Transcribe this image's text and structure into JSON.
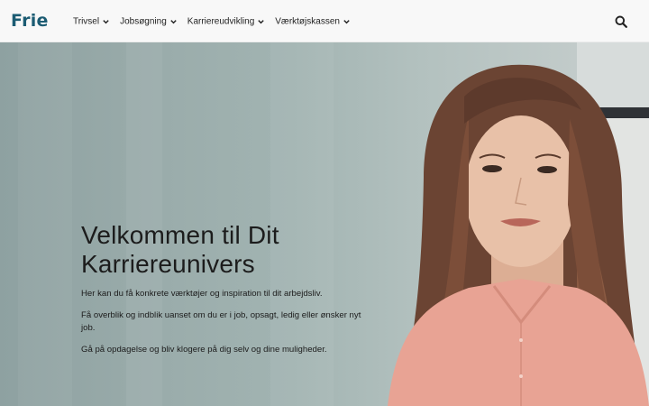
{
  "header": {
    "logo": "Frie",
    "nav": [
      {
        "label": "Trivsel"
      },
      {
        "label": "Jobsøgning"
      },
      {
        "label": "Karriereudvikling"
      },
      {
        "label": "Værktøjskassen"
      }
    ],
    "search_icon": "search-icon"
  },
  "hero": {
    "title": "Velkommen til Dit Karriereunivers",
    "paragraphs": [
      "Her kan du få konkrete værktøjer og inspiration til dit arbejdsliv.",
      "Få overblik og indblik uanset om du er i job, opsagt, ledig eller ønsker nyt job.",
      "Gå på opdagelse og bliv klogere på dig selv og dine muligheder."
    ]
  },
  "colors": {
    "brand": "#1c5c73",
    "background_left": "#8ea1a1",
    "background_right": "#c9d0cf",
    "shirt": "#e8a394",
    "hair": "#6b4433"
  }
}
